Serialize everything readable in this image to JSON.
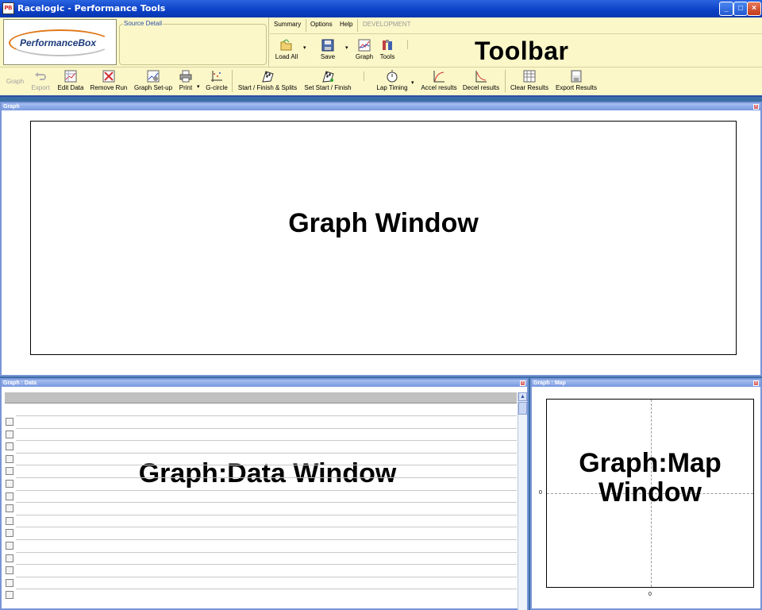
{
  "window": {
    "app_icon": "PB",
    "title": "Racelogic - Performance Tools",
    "minimize": "_",
    "maximize": "□",
    "close": "×"
  },
  "logo": {
    "text": "PerformanceBox"
  },
  "source_detail": {
    "legend": "Source Detail"
  },
  "menu": {
    "items": [
      "Summary",
      "Options",
      "Help",
      "DEVELOPMENT"
    ]
  },
  "toolbar_top": {
    "load_all": "Load All",
    "save": "Save",
    "graph": "Graph",
    "tools": "Tools"
  },
  "toolbar_label": "Toolbar",
  "toolbar_bottom": {
    "graph": "Graph",
    "export": "Export",
    "edit_data": "Edit Data",
    "remove_run": "Remove Run",
    "graph_setup": "Graph Set-up",
    "print": "Print",
    "g_circle": "G-circle",
    "start_finish_splits": "Start / Finish & Splits",
    "set_start_finish": "Set Start / Finish",
    "lap_timing": "Lap Timing",
    "accel_results": "Accel results",
    "decel_results": "Decel results",
    "clear_results": "Clear Results",
    "export_results": "Export Results"
  },
  "graph_panel": {
    "title": "Graph",
    "label": "Graph Window"
  },
  "data_panel": {
    "title": "Graph : Data",
    "label": "Graph:Data Window"
  },
  "map_panel": {
    "title": "Graph : Map",
    "label_line1": "Graph:Map",
    "label_line2": "Window",
    "x_tick": "0",
    "y_tick": "0"
  },
  "icons": {
    "load": "folder-open-icon",
    "save": "floppy-disk-icon",
    "graph": "graph-icon",
    "tools": "tools-icon",
    "stopwatch": "stopwatch-icon"
  },
  "colors": {
    "toolbar_bg": "#fbf7c8",
    "titlebar": "#0a3fc4",
    "panel_border": "#7a96d8"
  }
}
